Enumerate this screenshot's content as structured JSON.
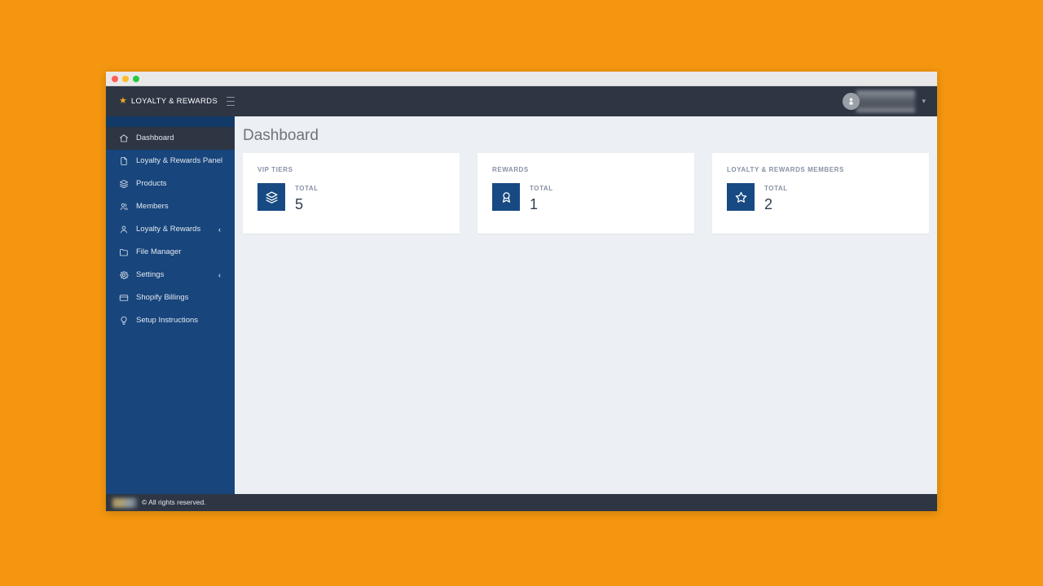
{
  "window": {
    "traffic_lights": [
      "close",
      "minimize",
      "maximize"
    ]
  },
  "header": {
    "brand_star_icon": "star-icon",
    "brand_text": "LOYALTY & REWARDS",
    "menu_toggle_icon": "hamburger-icon",
    "avatar_icon": "user-avatar-icon",
    "user_name": "",
    "dropdown_icon": "chevron-down-icon"
  },
  "sidebar": {
    "items": [
      {
        "label": "Dashboard",
        "icon": "home-icon",
        "active": true,
        "chevron": ""
      },
      {
        "label": "Loyalty & Rewards Panel",
        "icon": "file-icon",
        "active": false,
        "chevron": ""
      },
      {
        "label": "Products",
        "icon": "layers-icon",
        "active": false,
        "chevron": ""
      },
      {
        "label": "Members",
        "icon": "users-icon",
        "active": false,
        "chevron": ""
      },
      {
        "label": "Loyalty & Rewards",
        "icon": "user-icon",
        "active": false,
        "chevron": "‹"
      },
      {
        "label": "File Manager",
        "icon": "folder-icon",
        "active": false,
        "chevron": ""
      },
      {
        "label": "Settings",
        "icon": "gear-icon",
        "active": false,
        "chevron": "‹"
      },
      {
        "label": "Shopify Billings",
        "icon": "credit-card-icon",
        "active": false,
        "chevron": ""
      },
      {
        "label": "Setup Instructions",
        "icon": "lightbulb-icon",
        "active": false,
        "chevron": ""
      }
    ]
  },
  "main": {
    "page_title": "Dashboard",
    "cards": [
      {
        "label": "VIP TIERS",
        "icon": "layers-icon",
        "total_label": "TOTAL",
        "value": "5"
      },
      {
        "label": "REWARDS",
        "icon": "award-ribbon-icon",
        "total_label": "TOTAL",
        "value": "1"
      },
      {
        "label": "LOYALTY & REWARDS MEMBERS",
        "icon": "star-outline-icon",
        "total_label": "TOTAL",
        "value": "2"
      }
    ]
  },
  "footer": {
    "copyright": "© All rights reserved."
  },
  "colors": {
    "page_background": "#f4960f",
    "sidebar": "#17457c",
    "header": "#2e3644",
    "content_background": "#eceff3",
    "card_icon": "#174a82",
    "brand_accent": "#f5a623"
  }
}
